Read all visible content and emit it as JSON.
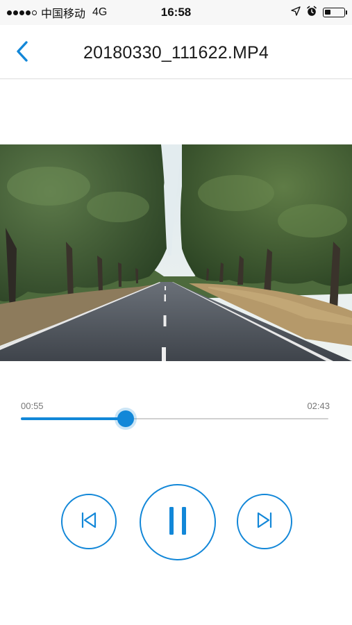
{
  "status_bar": {
    "carrier": "中国移动",
    "network": "4G",
    "time": "16:58",
    "signal_bars_filled": 4,
    "signal_bars_total": 5,
    "battery_level": 0.3,
    "icons": [
      "location-arrow-icon",
      "alarm-clock-icon",
      "battery-icon"
    ]
  },
  "nav": {
    "title": "20180330_111622.MP4",
    "back_icon": "chevron-left-icon"
  },
  "player": {
    "current_time": "00:55",
    "total_time": "02:43",
    "progress": 0.34,
    "controls": {
      "previous_icon": "skip-previous-icon",
      "pause_icon": "pause-icon",
      "next_icon": "skip-next-icon"
    }
  },
  "colors": {
    "accent": "#1287d8",
    "track": "#d0d0d0",
    "status_bar_bg": "#f7f7f7"
  }
}
